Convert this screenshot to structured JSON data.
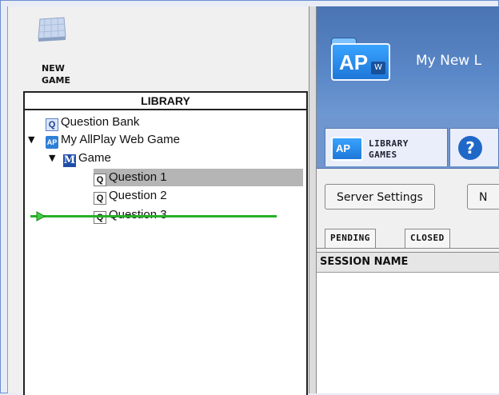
{
  "left": {
    "new_game_label_line1": "NEW",
    "new_game_label_line2": "GAME",
    "library_title": "LIBRARY",
    "tree": {
      "question_bank": "Question Bank",
      "web_game": "My AllPlay Web Game",
      "game": "Game",
      "questions": [
        "Question 1",
        "Question 2",
        "Question 3"
      ]
    },
    "icons": {
      "question_bank": "Q",
      "question": "Q",
      "allplay": "AP",
      "game": "M"
    }
  },
  "right": {
    "app_title": "My New L",
    "logo_text": "AP",
    "logo_badge": "W",
    "tabs": {
      "library_line1": "LIBRARY",
      "library_line2": "GAMES",
      "help": "?"
    },
    "buttons": {
      "server_settings": "Server Settings",
      "next_partial": "N"
    },
    "session_tabs": [
      "PENDING",
      "CLOSED"
    ],
    "table": {
      "columns": [
        "SESSION NAME"
      ]
    }
  },
  "colors": {
    "banner": "#5a87c7",
    "selection": "#b5b5b5",
    "drop_indicator": "#27b027",
    "frame": "#6d8fcf"
  }
}
